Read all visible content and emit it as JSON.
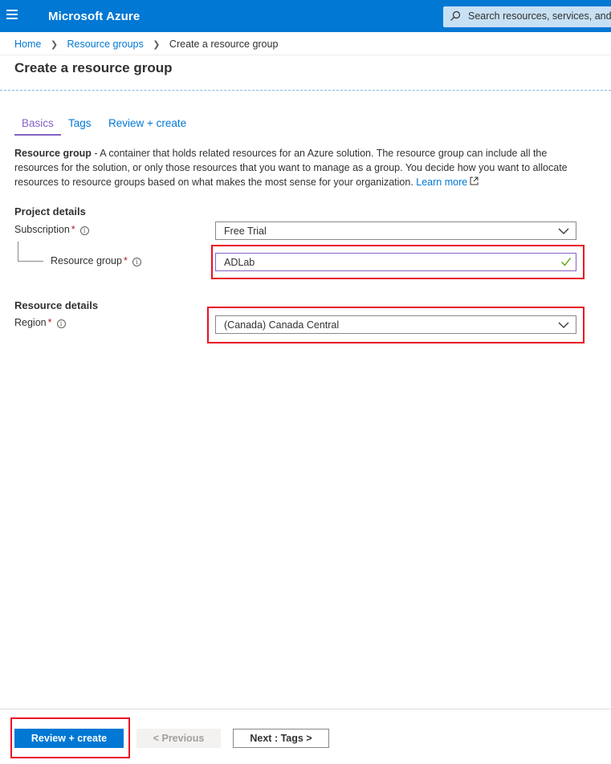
{
  "header": {
    "brand": "Microsoft Azure",
    "search_placeholder": "Search resources, services, and docs"
  },
  "breadcrumb": {
    "items": [
      "Home",
      "Resource groups"
    ],
    "current": "Create a resource group"
  },
  "page": {
    "title": "Create a resource group"
  },
  "tabs": [
    {
      "label": "Basics",
      "active": true
    },
    {
      "label": "Tags",
      "active": false
    },
    {
      "label": "Review + create",
      "active": false
    }
  ],
  "description": {
    "bold": "Resource group",
    "text": " - A container that holds related resources for an Azure solution. The resource group can include all the resources for the solution, or only those resources that you want to manage as a group. You decide how you want to allocate resources to resource groups based on what makes the most sense for your organization. ",
    "link": "Learn more"
  },
  "project_details": {
    "title": "Project details",
    "subscription_label": "Subscription",
    "subscription_value": "Free Trial",
    "resource_group_label": "Resource group",
    "resource_group_value": "ADLab"
  },
  "resource_details": {
    "title": "Resource details",
    "region_label": "Region",
    "region_value": "(Canada) Canada Central"
  },
  "required_marker": "*",
  "footer": {
    "review_create": "Review + create",
    "previous": "< Previous",
    "next": "Next : Tags >"
  },
  "colors": {
    "brand_blue": "#0078d4",
    "active_tab": "#8661c5",
    "highlight_red": "#e81123",
    "required_red": "#a4262c",
    "valid_green": "#57a300"
  }
}
